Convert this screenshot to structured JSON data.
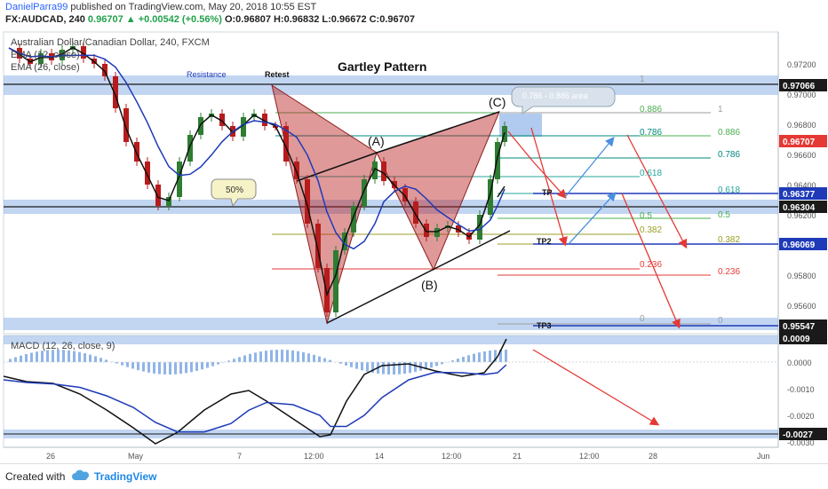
{
  "header": {
    "author": "DanielParra99",
    "published_text": "published on TradingView.com, May 20, 2018 10:55 EST",
    "symbol": "FX:AUDCAD, 240",
    "price": "0.96707",
    "change": "▲ +0.00542 (+0.56%)",
    "ohlc": "O:0.96807 H:0.96832 L:0.96672 C:0.96707"
  },
  "legend": {
    "instrument": "Australian Dollar/Canadian Dollar, 240, FXCM",
    "ema1": "EMA (12, close)",
    "ema2": "EMA (26, close)",
    "macd": "MACD (12, 26, close, 9)"
  },
  "annotations": {
    "title": "Gartley Pattern",
    "resistance": "Resistance",
    "retest": "Retest",
    "fifty": "50%",
    "area_note": "0.786 - 0.886 area",
    "point_a": "(A)",
    "point_b": "(B)",
    "point_c": "(C)",
    "tp1": "TP",
    "tp2": "TP2",
    "tp3": "TP3"
  },
  "fib_left": [
    {
      "label": "1",
      "color": "#9e9e9e"
    },
    {
      "label": "0.886",
      "color": "#4caf50"
    },
    {
      "label": "0.786",
      "color": "#00897b"
    },
    {
      "label": "0.618",
      "color": "#26a69a"
    },
    {
      "label": "0.5",
      "color": "#4caf50"
    },
    {
      "label": "0.382",
      "color": "#9e9d24"
    },
    {
      "label": "0.236",
      "color": "#e53935"
    },
    {
      "label": "0",
      "color": "#9e9e9e"
    }
  ],
  "fib_right": [
    {
      "label": "1",
      "color": "#9e9e9e"
    },
    {
      "label": "0.886",
      "color": "#4caf50"
    },
    {
      "label": "0.786",
      "color": "#00897b"
    },
    {
      "label": "0.618",
      "color": "#26a69a"
    },
    {
      "label": "0.5",
      "color": "#4caf50"
    },
    {
      "label": "0.382",
      "color": "#9e9d24"
    },
    {
      "label": "0.236",
      "color": "#e53935"
    },
    {
      "label": "0",
      "color": "#9e9e9e"
    }
  ],
  "price_axis": {
    "ticks": [
      "0.97200",
      "0.97000",
      "0.96800",
      "0.96600",
      "0.96400",
      "0.96200",
      "0.96000",
      "0.95800",
      "0.95600"
    ],
    "tags": [
      {
        "label": "0.97066",
        "bg": "#1a1a1a",
        "fg": "#ffffff"
      },
      {
        "label": "0.96707",
        "bg": "#e53935",
        "fg": "#ffffff"
      },
      {
        "label": "0.96377",
        "bg": "#1e3ab8",
        "fg": "#ffffff"
      },
      {
        "label": "0.96304",
        "bg": "#1a1a1a",
        "fg": "#ffffff"
      },
      {
        "label": "0.96069",
        "bg": "#1e3ab8",
        "fg": "#ffffff"
      },
      {
        "label": "0.95547",
        "bg": "#1a1a1a",
        "fg": "#ffffff"
      }
    ]
  },
  "macd_axis": {
    "ticks": [
      "0.0000",
      "-0.0010",
      "-0.0020",
      "-0.0030"
    ],
    "tags": [
      {
        "label": "0.0009",
        "bg": "#1a1a1a",
        "fg": "#ffffff"
      },
      {
        "label": "-0.0027",
        "bg": "#1a1a1a",
        "fg": "#ffffff"
      }
    ]
  },
  "time_axis": [
    "26",
    "May",
    "7",
    "12:00",
    "14",
    "12:00",
    "21",
    "12:00",
    "28",
    "Jun"
  ],
  "footer": {
    "created": "Created with",
    "brand": "TradingView"
  },
  "colors": {
    "pattern_fill": "#b71c1c",
    "zone_fill": "#90b4e8",
    "ema_fast": "#111111",
    "ema_slow": "#1e3ab8",
    "candle_up": "#2e7d32",
    "candle_down": "#b71c1c",
    "arrow_red": "#e53935",
    "arrow_blue": "#4a8fe0"
  }
}
